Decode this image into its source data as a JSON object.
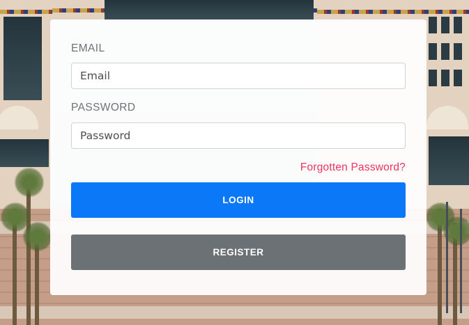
{
  "form": {
    "email_label": "EMAIL",
    "email_placeholder": "Email",
    "password_label": "PASSWORD",
    "password_placeholder": "Password",
    "forgot_link": "Forgotten Password?",
    "login_button": "LOGIN",
    "register_button": "REGISTER"
  },
  "colors": {
    "primary": "#0a78f7",
    "secondary": "#6b7175",
    "link": "#f0315f",
    "label": "#6c7478"
  }
}
